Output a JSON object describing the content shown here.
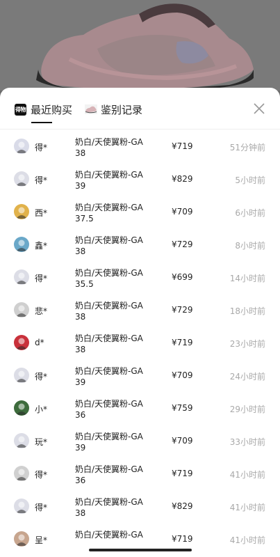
{
  "tabs": {
    "recent": "最近购买",
    "authentication": "鉴别记录",
    "logo_text": "得物"
  },
  "icons": {
    "logo": "dewu-logo-icon",
    "shoe": "shoe-thumbnail-icon",
    "close": "close-icon"
  },
  "colors": {
    "text": "#222222",
    "muted": "#a9a9a9",
    "sheet": "#ffffff"
  },
  "purchases": [
    {
      "name": "得*",
      "sku_line1": "奶白/天使翼粉-GA",
      "sku_line2": "38",
      "price": "¥719",
      "time": "51分钟前",
      "avatar": "#d9dbe8"
    },
    {
      "name": "得*",
      "sku_line1": "奶白/天使翼粉-GA",
      "sku_line2": "39",
      "price": "¥829",
      "time": "5小时前",
      "avatar": "#dcdde6"
    },
    {
      "name": "西*",
      "sku_line1": "奶白/天使翼粉-GA",
      "sku_line2": "37.5",
      "price": "¥709",
      "time": "6小时前",
      "avatar": "#e1b24b"
    },
    {
      "name": "鑫*",
      "sku_line1": "奶白/天使翼粉-GA",
      "sku_line2": "38",
      "price": "¥729",
      "time": "8小时前",
      "avatar": "#6aa8c9"
    },
    {
      "name": "得*",
      "sku_line1": "奶白/天使翼粉-GA",
      "sku_line2": "35.5",
      "price": "¥699",
      "time": "14小时前",
      "avatar": "#dcdde6"
    },
    {
      "name": "悲*",
      "sku_line1": "奶白/天使翼粉-GA",
      "sku_line2": "38",
      "price": "¥729",
      "time": "18小时前",
      "avatar": "#cfcfcf"
    },
    {
      "name": "d*",
      "sku_line1": "奶白/天使翼粉-GA",
      "sku_line2": "38",
      "price": "¥719",
      "time": "23小时前",
      "avatar": "#c9313b"
    },
    {
      "name": "得*",
      "sku_line1": "奶白/天使翼粉-GA",
      "sku_line2": "39",
      "price": "¥709",
      "time": "24小时前",
      "avatar": "#dcdde6"
    },
    {
      "name": "小*",
      "sku_line1": "奶白/天使翼粉-GA",
      "sku_line2": "36",
      "price": "¥759",
      "time": "29小时前",
      "avatar": "#3d6b3c"
    },
    {
      "name": "玩*",
      "sku_line1": "奶白/天使翼粉-GA",
      "sku_line2": "39",
      "price": "¥709",
      "time": "33小时前",
      "avatar": "#dcdde6"
    },
    {
      "name": "得*",
      "sku_line1": "奶白/天使翼粉-GA",
      "sku_line2": "36",
      "price": "¥719",
      "time": "41小时前",
      "avatar": "#d0d0d0"
    },
    {
      "name": "得*",
      "sku_line1": "奶白/天使翼粉-GA",
      "sku_line2": "38",
      "price": "¥829",
      "time": "41小时前",
      "avatar": "#dcdde6"
    },
    {
      "name": "呈*",
      "sku_line1": "奶白/天使翼粉-GA",
      "sku_line2": "",
      "price": "¥719",
      "time": "41小时前",
      "avatar": "#c7a58e"
    }
  ]
}
